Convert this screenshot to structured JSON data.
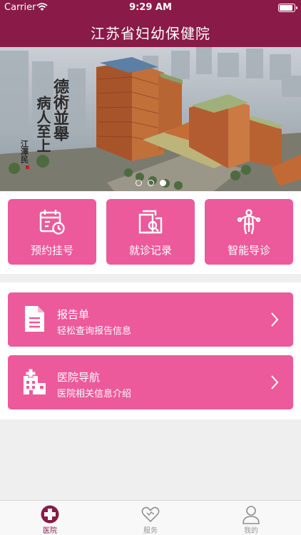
{
  "status_bar": {
    "carrier": "Carrier",
    "time": "9:29 AM"
  },
  "header": {
    "title": "江苏省妇幼保健院"
  },
  "banner": {
    "calligraphy_lines": [
      "德術並舉",
      "病人至上"
    ],
    "signature": "江澤民",
    "slide_count": 3,
    "active_slide": 3
  },
  "quick_actions": [
    {
      "label": "预约挂号",
      "icon": "calendar-clock-icon"
    },
    {
      "label": "就诊记录",
      "icon": "records-search-icon"
    },
    {
      "label": "智能导诊",
      "icon": "body-guide-icon"
    }
  ],
  "list_items": [
    {
      "title": "报告单",
      "subtitle": "轻松查询报告信息",
      "icon": "document-icon"
    },
    {
      "title": "医院导航",
      "subtitle": "医院相关信息介绍",
      "icon": "hospital-building-icon"
    }
  ],
  "tab_bar": {
    "tabs": [
      {
        "label": "医院",
        "icon": "hospital-cross-icon",
        "active": true
      },
      {
        "label": "服务",
        "icon": "heart-icon",
        "active": false
      },
      {
        "label": "我的",
        "icon": "person-icon",
        "active": false
      }
    ]
  },
  "colors": {
    "header": "#8a1a47",
    "accent": "#ec5a9b",
    "background": "#efefef"
  }
}
